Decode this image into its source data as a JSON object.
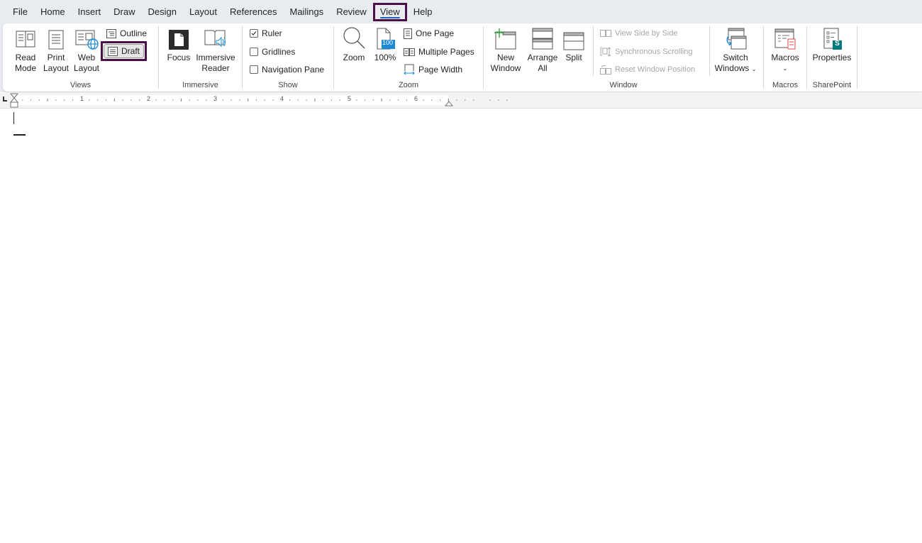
{
  "tabs": [
    {
      "label": "File",
      "active": false
    },
    {
      "label": "Home",
      "active": false
    },
    {
      "label": "Insert",
      "active": false
    },
    {
      "label": "Draw",
      "active": false
    },
    {
      "label": "Design",
      "active": false
    },
    {
      "label": "Layout",
      "active": false
    },
    {
      "label": "References",
      "active": false
    },
    {
      "label": "Mailings",
      "active": false
    },
    {
      "label": "Review",
      "active": false
    },
    {
      "label": "View",
      "active": true
    },
    {
      "label": "Help",
      "active": false
    }
  ],
  "ribbon": {
    "views": {
      "label": "Views",
      "read_mode": {
        "line1": "Read",
        "line2": "Mode"
      },
      "print_layout": {
        "line1": "Print",
        "line2": "Layout"
      },
      "web_layout": {
        "line1": "Web",
        "line2": "Layout"
      },
      "outline": "Outline",
      "draft": "Draft"
    },
    "immersive": {
      "label": "Immersive",
      "focus": "Focus",
      "immersive_reader": {
        "line1": "Immersive",
        "line2": "Reader"
      }
    },
    "show": {
      "label": "Show",
      "ruler": {
        "label": "Ruler",
        "checked": true
      },
      "gridlines": {
        "label": "Gridlines",
        "checked": false
      },
      "navigation_pane": {
        "label": "Navigation Pane",
        "checked": false
      }
    },
    "zoom": {
      "label": "Zoom",
      "zoom": "Zoom",
      "hundred": "100%",
      "hundred_badge": "100",
      "one_page": "One Page",
      "multiple_pages": "Multiple Pages",
      "page_width": "Page Width"
    },
    "window": {
      "label": "Window",
      "new_window": {
        "line1": "New",
        "line2": "Window"
      },
      "arrange_all": {
        "line1": "Arrange",
        "line2": "All"
      },
      "split": "Split",
      "view_side_by_side": "View Side by Side",
      "synchronous_scrolling": "Synchronous Scrolling",
      "reset_window_position": "Reset Window Position",
      "switch_windows": {
        "line1": "Switch",
        "line2": "Windows"
      }
    },
    "macros": {
      "label": "Macros",
      "macros": "Macros"
    },
    "sharepoint": {
      "label": "SharePoint",
      "properties": "Properties",
      "badge": "S"
    }
  },
  "ruler": {
    "numbers": [
      "1",
      "2",
      "3",
      "4",
      "5",
      "6"
    ]
  },
  "colors": {
    "highlight": "#4b0f48",
    "accent": "#1e63c4",
    "sharepoint": "#03787c"
  }
}
